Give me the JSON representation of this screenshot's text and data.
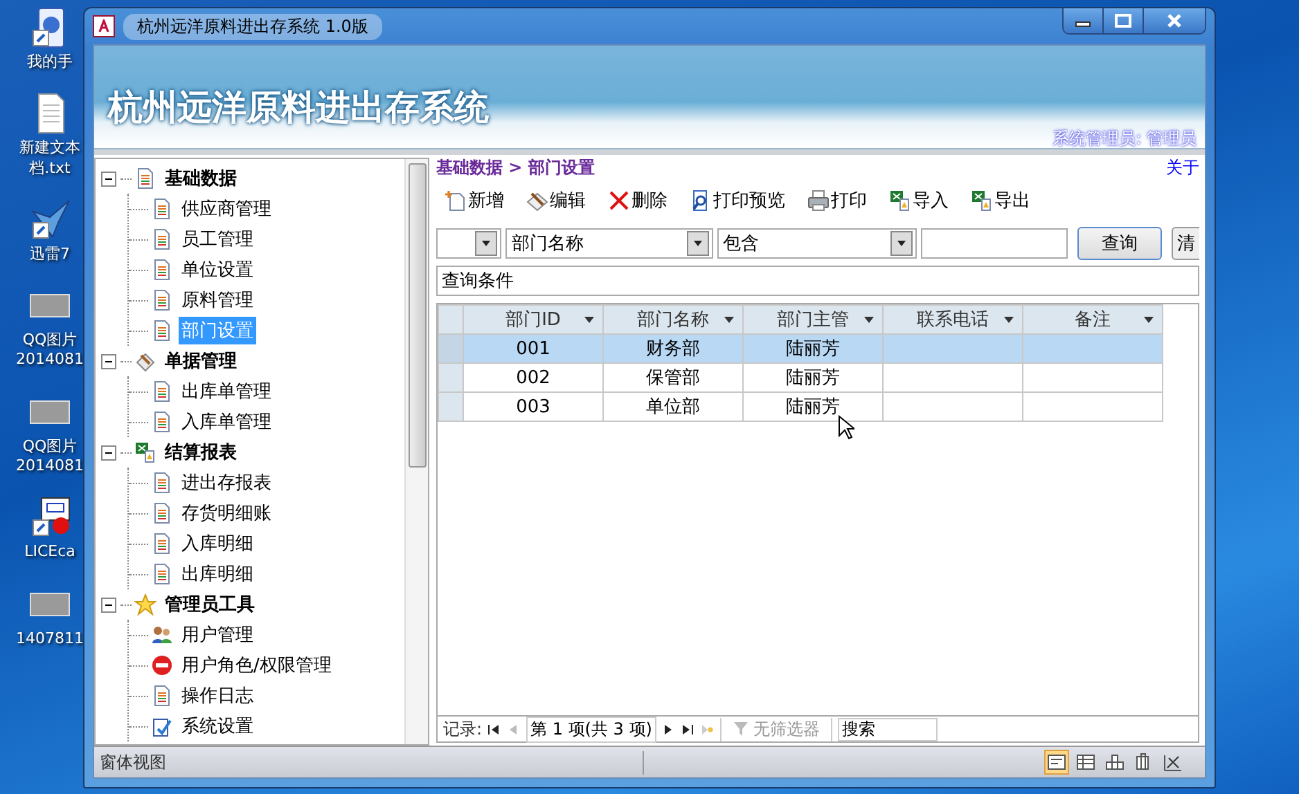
{
  "desktop": {
    "icons": [
      {
        "lines": [
          "我的手"
        ],
        "kind": "phone"
      },
      {
        "lines": [
          "新建文本",
          "档.txt"
        ],
        "kind": "text"
      },
      {
        "lines": [
          "迅雷7"
        ],
        "kind": "bird"
      },
      {
        "lines": [
          "QQ图片",
          "2014081"
        ],
        "kind": "image"
      },
      {
        "lines": [
          "QQ图片",
          "2014081"
        ],
        "kind": "image"
      },
      {
        "lines": [
          "LICEca"
        ],
        "kind": "app"
      },
      {
        "lines": [
          "1407811"
        ],
        "kind": "image"
      }
    ]
  },
  "window": {
    "title": "杭州远洋原料进出存系统 1.0版"
  },
  "banner": {
    "title": "杭州远洋原料进出存系统",
    "user": "系统管理员: 管理员"
  },
  "about_link": "关于",
  "tree": [
    {
      "label": "基础数据",
      "kind": "doc",
      "expanded": true,
      "children": [
        {
          "label": "供应商管理",
          "kind": "doc",
          "selected": false
        },
        {
          "label": "员工管理",
          "kind": "doc",
          "selected": false
        },
        {
          "label": "单位设置",
          "kind": "doc",
          "selected": false
        },
        {
          "label": "原料管理",
          "kind": "doc",
          "selected": false
        },
        {
          "label": "部门设置",
          "kind": "doc",
          "selected": true
        }
      ]
    },
    {
      "label": "单据管理",
      "kind": "tools",
      "expanded": true,
      "children": [
        {
          "label": "出库单管理",
          "kind": "doc",
          "selected": false
        },
        {
          "label": "入库单管理",
          "kind": "doc",
          "selected": false
        }
      ]
    },
    {
      "label": "结算报表",
      "kind": "sheet",
      "expanded": true,
      "children": [
        {
          "label": "进出存报表",
          "kind": "doc",
          "selected": false
        },
        {
          "label": "存货明细账",
          "kind": "doc",
          "selected": false
        },
        {
          "label": "入库明细",
          "kind": "doc",
          "selected": false
        },
        {
          "label": "出库明细",
          "kind": "doc",
          "selected": false
        }
      ]
    },
    {
      "label": "管理员工具",
      "kind": "star",
      "expanded": true,
      "children": [
        {
          "label": "用户管理",
          "kind": "users",
          "selected": false
        },
        {
          "label": "用户角色/权限管理",
          "kind": "stop",
          "selected": false
        },
        {
          "label": "操作日志",
          "kind": "doc",
          "selected": false
        },
        {
          "label": "系统设置",
          "kind": "settings",
          "selected": false
        }
      ]
    }
  ],
  "breadcrumb": "基础数据 > 部门设置",
  "toolbar": [
    {
      "label": "新增",
      "kind": "new"
    },
    {
      "label": "编辑",
      "kind": "edit"
    },
    {
      "label": "删除",
      "kind": "delete"
    },
    {
      "label": "打印预览",
      "kind": "preview"
    },
    {
      "label": "打印",
      "kind": "print"
    },
    {
      "label": "导入",
      "kind": "sheet"
    },
    {
      "label": "导出",
      "kind": "sheet"
    }
  ],
  "filter": {
    "field": "部门名称",
    "operator": "包含",
    "query_button": "查询",
    "clear_button": "清",
    "condition": "查询条件"
  },
  "table": {
    "columns": [
      "部门ID",
      "部门名称",
      "部门主管",
      "联系电话",
      "备注"
    ],
    "rows": [
      {
        "cells": [
          "001",
          "财务部",
          "陆丽芳",
          "",
          ""
        ],
        "selected": true
      },
      {
        "cells": [
          "002",
          "保管部",
          "陆丽芳",
          "",
          ""
        ],
        "selected": false
      },
      {
        "cells": [
          "003",
          "单位部",
          "陆丽芳",
          "",
          ""
        ],
        "selected": false
      }
    ]
  },
  "navigator": {
    "label": "记录:",
    "position": "第 1 项(共 3 项)",
    "filter": "无筛选器",
    "search_placeholder": "搜索"
  },
  "status_bar": {
    "text": "窗体视图",
    "views": [
      {
        "kind": "form",
        "selected": true
      },
      {
        "kind": "sheet",
        "selected": false
      },
      {
        "kind": "pivot",
        "selected": false
      },
      {
        "kind": "chart",
        "selected": false
      },
      {
        "kind": "design",
        "selected": false
      }
    ]
  }
}
